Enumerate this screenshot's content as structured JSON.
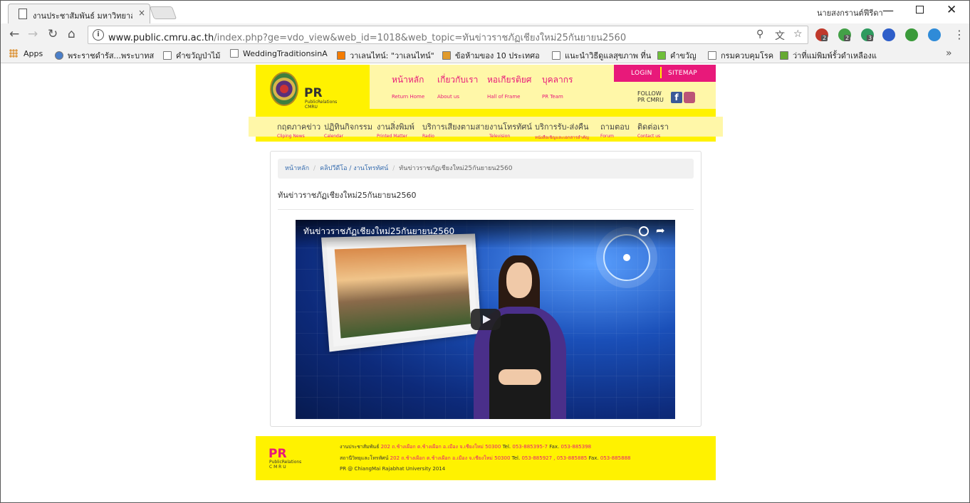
{
  "browser": {
    "tab_title": "งานประชาสัมพันธ์ มหาวิทยาลั",
    "tab_close": "×",
    "profile_name": "นายสงกรานต์ฟีรีดา",
    "url_host": "www.public.cmru.ac.th",
    "url_path": "/index.php?ge=vdo_view&web_id=1018&web_topic=ทันข่าวราชภัฏเชียงใหม่25กันยายน2560",
    "back": "←",
    "forward": "→",
    "reload": "↻",
    "home": "⌂",
    "info": "i",
    "menu": "⋮",
    "win_min": "—",
    "win_close": "✕",
    "omni_icons": {
      "zoom": "⚲",
      "translate": "文",
      "star": "☆"
    },
    "extensions": [
      {
        "name": "abp",
        "badge": "2",
        "color": "#c0392b"
      },
      {
        "name": "shield-check",
        "badge": "2",
        "color": "#43a047"
      },
      {
        "name": "vpn",
        "badge": "3",
        "color": "#2e9b5f"
      },
      {
        "name": "privacy-badger",
        "badge": "",
        "color": "#2e5ec9"
      },
      {
        "name": "frog",
        "badge": "",
        "color": "#3a9a3a"
      },
      {
        "name": "todo-check",
        "badge": "",
        "color": "#2f8bd8"
      }
    ]
  },
  "bookmarks": {
    "apps": "Apps",
    "items": [
      "พระราชดำรัส...พระบาทส",
      "คำขวัญป่าไม้",
      "WeddingTraditionsinA",
      "วาเลนไทน์: \"วาเลนไทน์\"",
      "ข้อห้ามของ 10 ประเทศอ",
      "แนะนำวิธีดูแลสุขภาพ ที่น",
      "คำขวัญ",
      "กรมควบคุมโรค",
      "ว่าที่แม่พิมพ์รั้วดำเหลืองแ"
    ],
    "more": "»"
  },
  "header": {
    "pr": "PR",
    "pr_sub_1": "PublicRelations",
    "pr_sub_2": "CMRU",
    "top_nav": [
      {
        "th": "หน้าหลัก",
        "en": "Return Home"
      },
      {
        "th": "เกี่ยวกับเรา",
        "en": "About us"
      },
      {
        "th": "หอเกียรติยศ",
        "en": "Hall of Frame"
      },
      {
        "th": "บุคลากร",
        "en": "PR Team"
      }
    ],
    "login": "LOGIN",
    "sitemap": "SITEMAP",
    "follow_1": "FOLLOW",
    "follow_2": "PR CMRU",
    "fb": "f",
    "main_nav": [
      {
        "th": "กฤตภาคข่าว",
        "en": "Cliping News"
      },
      {
        "th": "ปฏิทินกิจกรรม",
        "en": "Calendar"
      },
      {
        "th": "งานสิ่งพิมพ์",
        "en": "Printed Matter"
      },
      {
        "th": "บริการเสียงตามสาย",
        "en": "Radio"
      },
      {
        "th": "งานโทรทัศน์",
        "en": "Television"
      },
      {
        "th": "บริการรับ-ส่งคืน",
        "en": "หนังสือเชิญและเอกสารสำคัญ"
      },
      {
        "th": "ถามตอบ",
        "en": "Forum"
      },
      {
        "th": "ติดต่อเรา",
        "en": "Contact us"
      }
    ]
  },
  "content": {
    "breadcrumb": {
      "home": "หน้าหลัก",
      "clips": "คลิปวีดีโอ / งานโทรทัศน์",
      "current": "ทันข่าวราชภัฏเชียงใหม่25กันยายน2560",
      "sep": "/"
    },
    "title": "ทันข่าวราชภัฏเชียงใหม่25กันยายน2560",
    "video_title": "ทันข่าวราชภัฏเชียงใหม่25กันยายน2560",
    "share": "➦"
  },
  "footer": {
    "pr": "PR",
    "sub_1": "PublicRelations",
    "sub_2": "C M R U",
    "line1_label": "งานประชาสัมพันธ์",
    "line1_addr": "202 ถ.ช้างเผือก ต.ช้างเผือก อ.เมือง จ.เชียงใหม่ 50300",
    "line1_tel_label": "Tel.",
    "line1_tel": "053-885395-7",
    "line1_fax_label": "Fax.",
    "line1_fax": "053-885398",
    "line2_label": "สถานีวิทยุและโทรทัศน์",
    "line2_addr": "202 ถ.ช้างเผือก ต.ช้างเผือก อ.เมือง จ.เชียงใหม่ 50300",
    "line2_tel_label": "Tel.",
    "line2_tel": "053-885927 , 053-885885",
    "line2_fax_label": "Fax.",
    "line2_fax": "053-885888",
    "line3": "PR @ ChiangMai Rajabhat University 2014"
  }
}
